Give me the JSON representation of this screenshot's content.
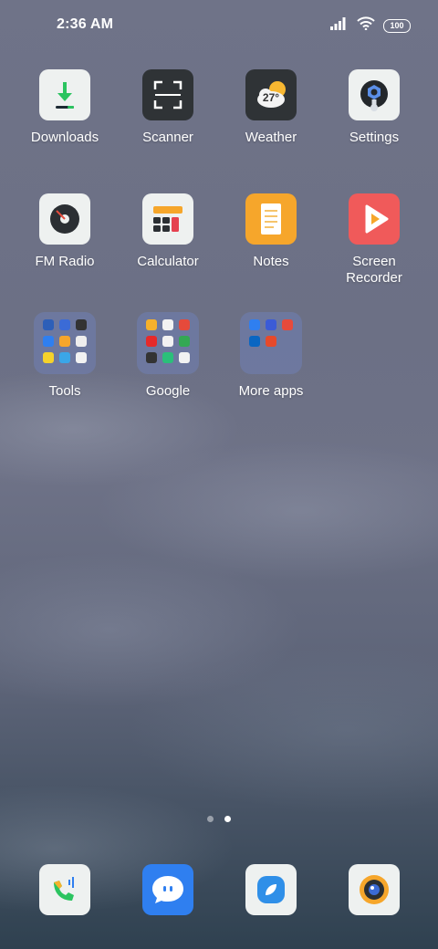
{
  "status_bar": {
    "time": "2:36 AM",
    "battery": "100",
    "icons": [
      "signal-icon",
      "wifi-icon",
      "battery-icon"
    ]
  },
  "apps": [
    {
      "label": "Downloads",
      "icon": "download-icon"
    },
    {
      "label": "Scanner",
      "icon": "scanner-icon"
    },
    {
      "label": "Weather",
      "icon": "weather-icon",
      "temperature": "27°"
    },
    {
      "label": "Settings",
      "icon": "settings-icon"
    },
    {
      "label": "FM Radio",
      "icon": "radio-icon"
    },
    {
      "label": "Calculator",
      "icon": "calculator-icon"
    },
    {
      "label": "Notes",
      "icon": "notes-icon"
    },
    {
      "label": "Screen Recorder",
      "icon": "screen-recorder-icon"
    }
  ],
  "folders": [
    {
      "label": "Tools",
      "app_count": 9
    },
    {
      "label": "Google",
      "app_count": 9
    },
    {
      "label": "More apps",
      "app_count": 5
    }
  ],
  "page_indicator": {
    "pages": 2,
    "current": 2
  },
  "dock": [
    {
      "name": "Phone",
      "icon": "phone-icon"
    },
    {
      "name": "Messages",
      "icon": "messages-icon"
    },
    {
      "name": "Browser",
      "icon": "browser-icon"
    },
    {
      "name": "Camera",
      "icon": "camera-icon"
    }
  ],
  "colors": {
    "notes": "#f6a62b",
    "recorder": "#f05a5a",
    "messages": "#2f7ff0",
    "page_dot_active": "#ffffff"
  }
}
